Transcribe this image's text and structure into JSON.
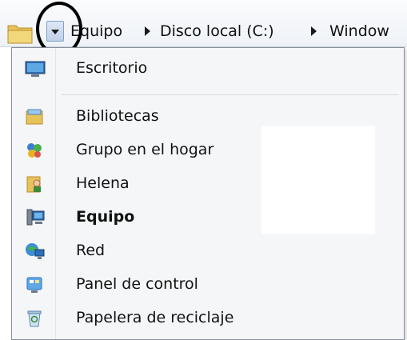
{
  "address_bar": {
    "crumbs": [
      "Equipo",
      "Disco local (C:)",
      "Window"
    ],
    "dropdown_tooltip": ""
  },
  "menu": {
    "items": [
      {
        "label": "Escritorio",
        "icon": "desktop-icon",
        "bold": false
      },
      {
        "label": "Bibliotecas",
        "icon": "libraries-icon",
        "bold": false
      },
      {
        "label": "Grupo en el hogar",
        "icon": "homegroup-icon",
        "bold": false
      },
      {
        "label": "Helena",
        "icon": "user-folder-icon",
        "bold": false
      },
      {
        "label": "Equipo",
        "icon": "computer-icon",
        "bold": true
      },
      {
        "label": "Red",
        "icon": "network-icon",
        "bold": false
      },
      {
        "label": "Panel de control",
        "icon": "control-panel-icon",
        "bold": false
      },
      {
        "label": "Papelera de reciclaje",
        "icon": "recycle-bin-icon",
        "bold": false
      }
    ]
  },
  "colors": {
    "menu_background": "#f4f6f8",
    "menu_border": "#8a9099",
    "highlight_circle": "#000000"
  }
}
